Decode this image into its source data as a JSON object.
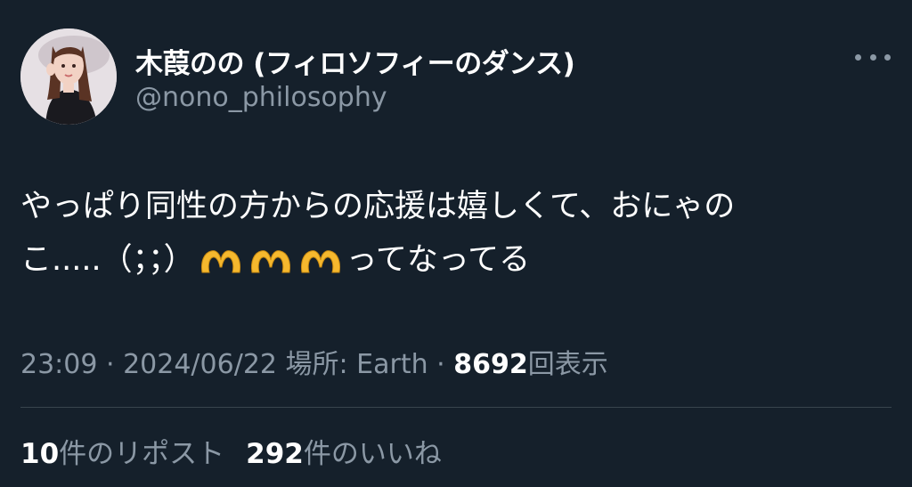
{
  "author": {
    "display_name": "木葭のの (フィロソフィーのダンス)",
    "handle": "@nono_philosophy"
  },
  "tweet": {
    "line1": "やっぱり同性の方からの応援は嬉しくて、おにゃの",
    "line2_prefix": "こ.....（；；）",
    "emoji": [
      "heart-hands",
      "heart-hands",
      "heart-hands"
    ],
    "line2_suffix": "ってなってる"
  },
  "meta": {
    "time": "23:09",
    "sep1": " · ",
    "date": "2024/06/22",
    "location_label": " 場所: Earth",
    "sep2": " · ",
    "views_count": "8692",
    "views_label": "回表示"
  },
  "stats": {
    "reposts_count": "10",
    "reposts_label": "件のリポスト",
    "likes_count": "292",
    "likes_label": "件のいいね"
  },
  "colors": {
    "background": "#15202b",
    "secondary_text": "#8b98a5",
    "divider": "#38444d",
    "emoji": "#f5b82e"
  }
}
